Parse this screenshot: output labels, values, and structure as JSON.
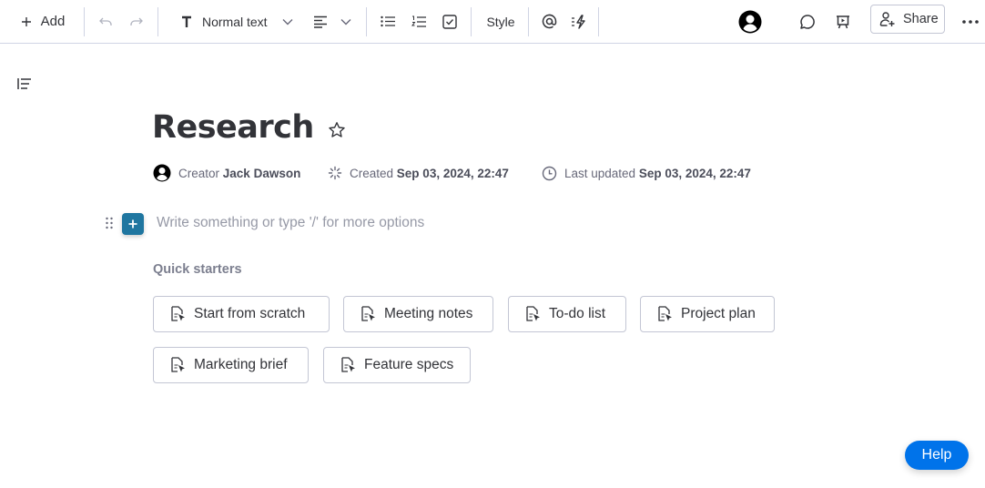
{
  "toolbar": {
    "add_label": "Add",
    "text_style_label": "Normal text",
    "style_label": "Style",
    "share_label": "Share",
    "icons": {
      "add": "plus-icon",
      "undo": "undo-icon",
      "redo": "redo-icon",
      "text_type": "text-t-icon",
      "chevron": "chevron-down-icon",
      "align": "align-left-icon",
      "bullet_list": "bullet-list-icon",
      "numbered_list": "numbered-list-icon",
      "checklist": "checkbox-icon",
      "mention": "at-mention-icon",
      "automation": "lightning-icon",
      "avatar": "user-avatar-icon",
      "comments": "comment-icon",
      "present": "presentation-icon",
      "share": "add-person-icon",
      "more": "more-horizontal-icon"
    }
  },
  "document": {
    "title": "Research",
    "meta": {
      "creator_label": "Creator",
      "creator_name": "Jack Dawson",
      "created_label": "Created",
      "created_value": "Sep 03, 2024, 22:47",
      "updated_label": "Last updated",
      "updated_value": "Sep 03, 2024, 22:47"
    },
    "editor_placeholder": "Write something or type '/' for more options",
    "quick_starters_label": "Quick starters",
    "quick_starters": [
      {
        "label": "Start from scratch"
      },
      {
        "label": "Meeting notes"
      },
      {
        "label": "To-do list"
      },
      {
        "label": "Project plan"
      },
      {
        "label": "Marketing brief"
      },
      {
        "label": "Feature specs"
      }
    ]
  },
  "help": {
    "label": "Help"
  },
  "colors": {
    "accent_block": "#1f76a0",
    "help_button": "#0073ea",
    "text_primary": "#323338",
    "text_secondary": "#676879",
    "border": "#c3c6d4"
  }
}
